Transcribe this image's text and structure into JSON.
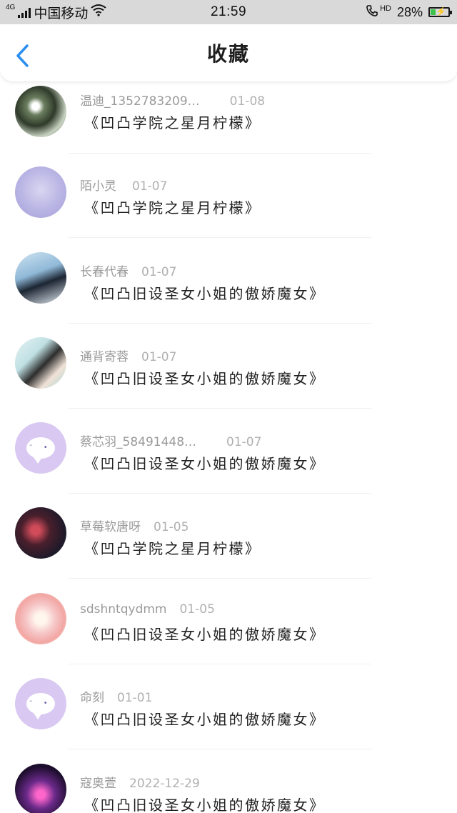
{
  "status_bar": {
    "network": "4G",
    "carrier": "中国移动",
    "time": "21:59",
    "hd": "HD",
    "battery": "28%",
    "battery_level": 0.28,
    "wifi_icon": "wifi-icon",
    "call_icon": "phone-icon"
  },
  "header": {
    "title": "收藏",
    "back_icon": "chevron-left-icon",
    "accent": "#2b8ff0"
  },
  "favorites": [
    {
      "user": "温迪_1352783209…",
      "date": "01-08",
      "book": "《凹凸学院之星月柠檬》",
      "avatar": "photo-illustration"
    },
    {
      "user": "陌小灵",
      "date": "01-07",
      "book": "《凹凸学院之星月柠檬》",
      "avatar": "photo-illustration"
    },
    {
      "user": "长春代春",
      "date": "01-07",
      "book": "《凹凸旧设圣女小姐的傲娇魔女》",
      "avatar": "photo-illustration"
    },
    {
      "user": "通背寄蓉",
      "date": "01-07",
      "book": "《凹凸旧设圣女小姐的傲娇魔女》",
      "avatar": "photo-illustration"
    },
    {
      "user": "蔡芯羽_58491448…",
      "date": "01-07",
      "book": "《凹凸旧设圣女小姐的傲娇魔女》",
      "avatar": "chat-bubble-icon"
    },
    {
      "user": "草莓软唐呀",
      "date": "01-05",
      "book": "《凹凸学院之星月柠檬》",
      "avatar": "photo-illustration"
    },
    {
      "user": "sdshntqydmm",
      "date": "01-05",
      "book": "《凹凸旧设圣女小姐的傲娇魔女》",
      "avatar": "photo-illustration"
    },
    {
      "user": "命刻",
      "date": "01-01",
      "book": "《凹凸旧设圣女小姐的傲娇魔女》",
      "avatar": "chat-bubble-icon"
    },
    {
      "user": "寇奥萱",
      "date": "2022-12-29",
      "book": "《凹凸旧设圣女小姐的傲娇魔女》",
      "avatar": "photo-illustration"
    }
  ]
}
